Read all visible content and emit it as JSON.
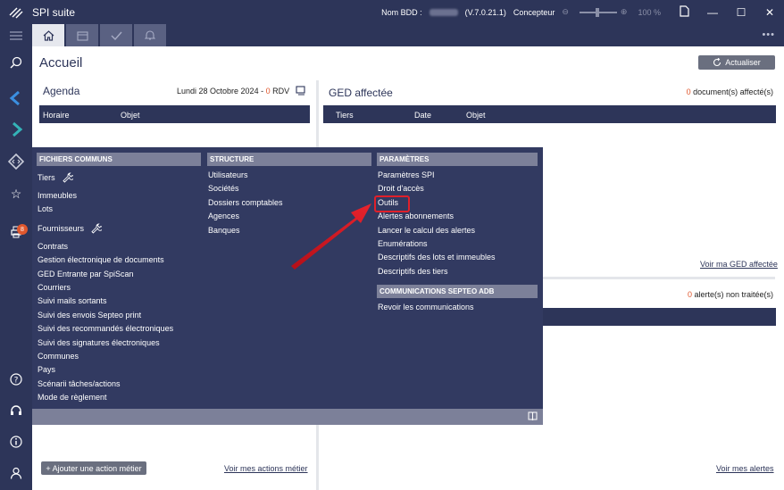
{
  "titlebar": {
    "app_title": "SPI suite",
    "db_label": "Nom BDD :",
    "version": "(V.7.0.21.1)",
    "role": "Concepteur",
    "zoom": "100 %"
  },
  "page": {
    "title": "Accueil",
    "refresh_label": "Actualiser"
  },
  "agenda": {
    "title": "Agenda",
    "date_prefix": "Lundi 28 Octobre 2024 - ",
    "rdv_count": "0",
    "rdv_suffix": " RDV",
    "columns": [
      "Horaire",
      "Objet"
    ],
    "add_action_label": "+ Ajouter une action métier",
    "see_actions_link": "Voir mes actions métier"
  },
  "ged": {
    "title": "GED affectée",
    "count": "0",
    "count_suffix": " document(s) affecté(s)",
    "columns": [
      "Tiers",
      "Date",
      "Objet"
    ],
    "see_link": "Voir ma GED affectée"
  },
  "alerts": {
    "count": "0",
    "count_suffix": " alerte(s) non traitée(s)",
    "see_link": "Voir mes alertes"
  },
  "sidebar": {
    "badge": "8"
  },
  "menu": {
    "fichiers": {
      "header": "FICHIERS COMMUNS",
      "items": [
        "Tiers",
        "Immeubles",
        "Lots",
        "Fournisseurs",
        "Contrats",
        "Gestion électronique de documents",
        "GED Entrante par SpiScan",
        "Courriers",
        "Suivi mails sortants",
        "Suivi des envois Septeo print",
        "Suivi des recommandés électroniques",
        "Suivi des signatures électroniques",
        "Communes",
        "Pays",
        "Scénarii tâches/actions",
        "Mode de règlement"
      ]
    },
    "structure": {
      "header": "STRUCTURE",
      "items": [
        "Utilisateurs",
        "Sociétés",
        "Dossiers comptables",
        "Agences",
        "Banques"
      ]
    },
    "parametres": {
      "header": "PARAMÈTRES",
      "items": [
        "Paramètres SPI",
        "Droit d'accès",
        "Outils",
        "Alertes abonnements",
        "Lancer le calcul des alertes",
        "Enumérations",
        "Descriptifs des lots et immeubles",
        "Descriptifs des tiers"
      ]
    },
    "communications": {
      "header": "COMMUNICATIONS SEPTEO ADB",
      "items": [
        "Revoir les communications"
      ]
    }
  },
  "colors": {
    "navy": "#2d3559",
    "flyout": "#323a61",
    "accent_orange": "#e0572d",
    "highlight_red": "#e0202a"
  }
}
